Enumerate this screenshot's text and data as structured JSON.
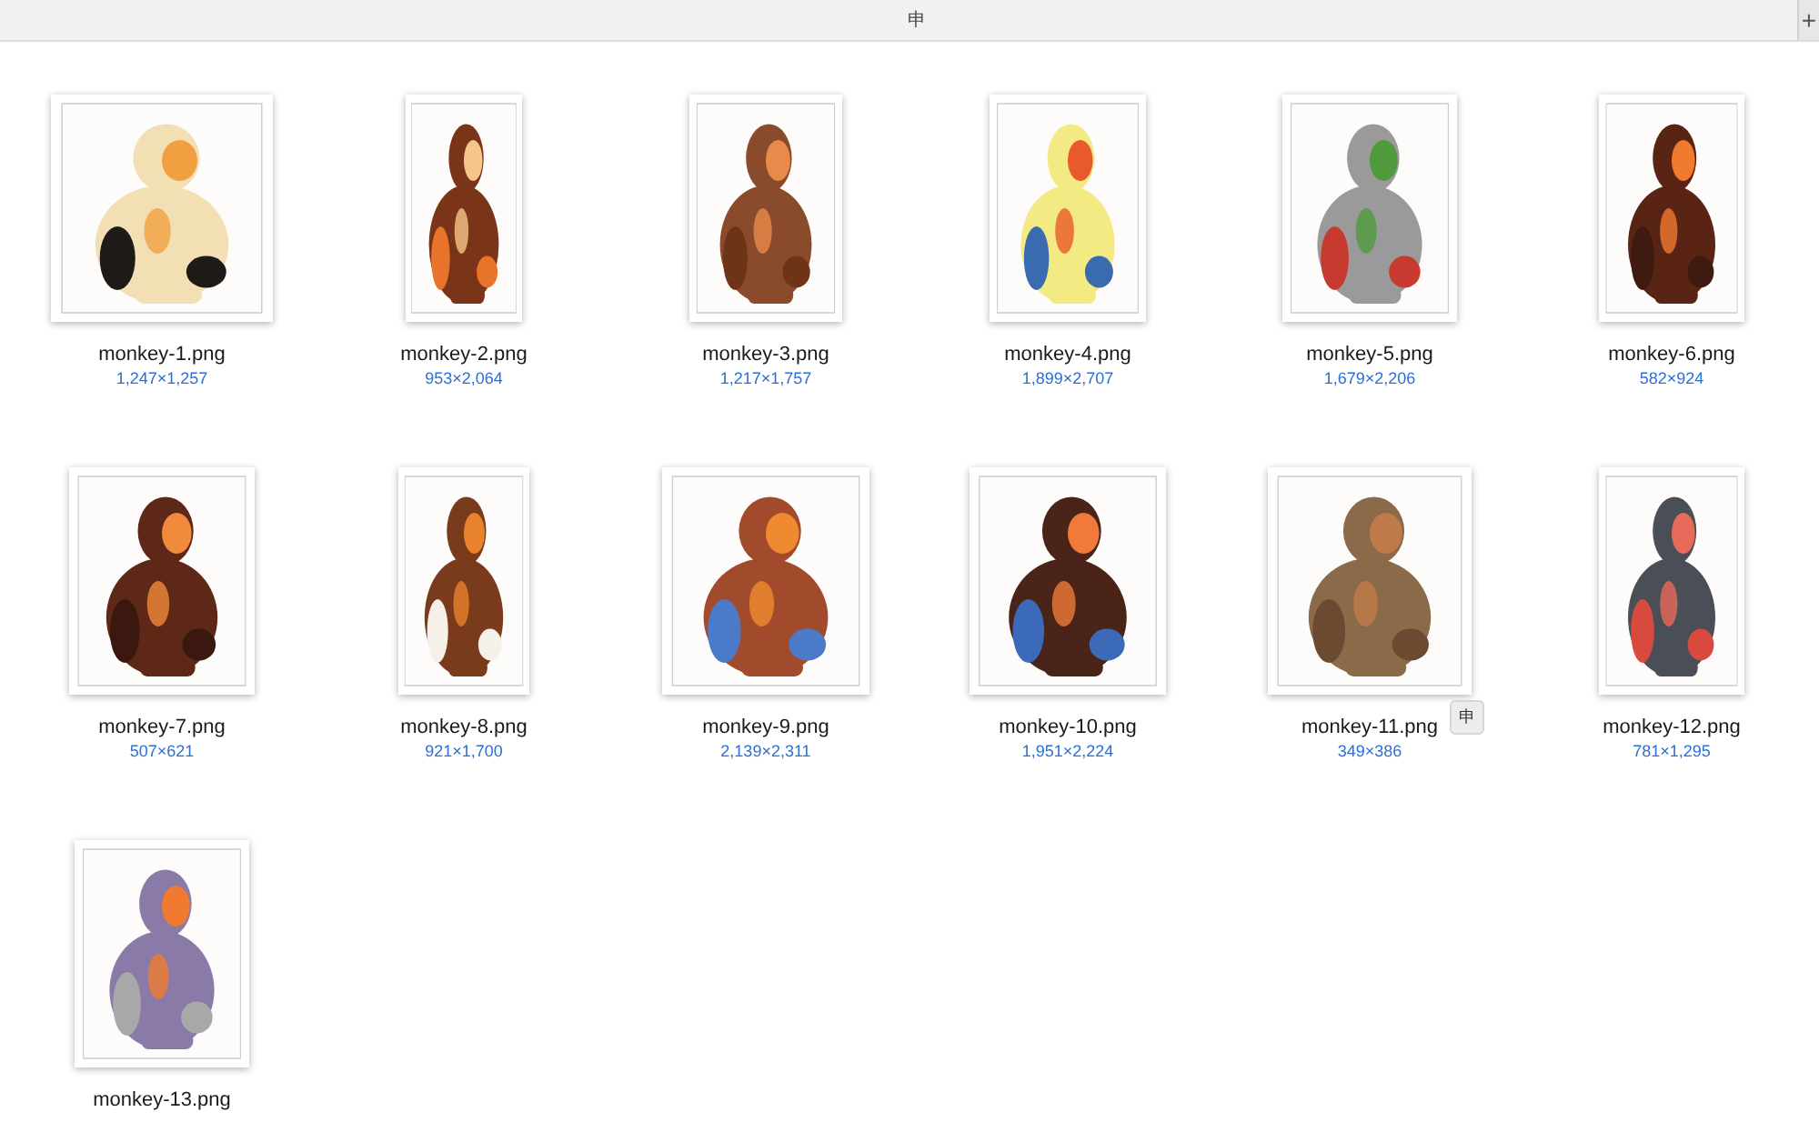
{
  "window": {
    "title": "申",
    "new_tab_button": "+"
  },
  "items": [
    {
      "name": "monkey-1.png",
      "dimensions": "1,247×1,257"
    },
    {
      "name": "monkey-2.png",
      "dimensions": "953×2,064"
    },
    {
      "name": "monkey-3.png",
      "dimensions": "1,217×1,757"
    },
    {
      "name": "monkey-4.png",
      "dimensions": "1,899×2,707"
    },
    {
      "name": "monkey-5.png",
      "dimensions": "1,679×2,206"
    },
    {
      "name": "monkey-6.png",
      "dimensions": "582×924"
    },
    {
      "name": "monkey-7.png",
      "dimensions": "507×621"
    },
    {
      "name": "monkey-8.png",
      "dimensions": "921×1,700"
    },
    {
      "name": "monkey-9.png",
      "dimensions": "2,139×2,311"
    },
    {
      "name": "monkey-10.png",
      "dimensions": "1,951×2,224"
    },
    {
      "name": "monkey-11.png",
      "dimensions": "349×386",
      "tooltip": "申"
    },
    {
      "name": "monkey-12.png",
      "dimensions": "781×1,295"
    },
    {
      "name": "monkey-13.png"
    }
  ]
}
